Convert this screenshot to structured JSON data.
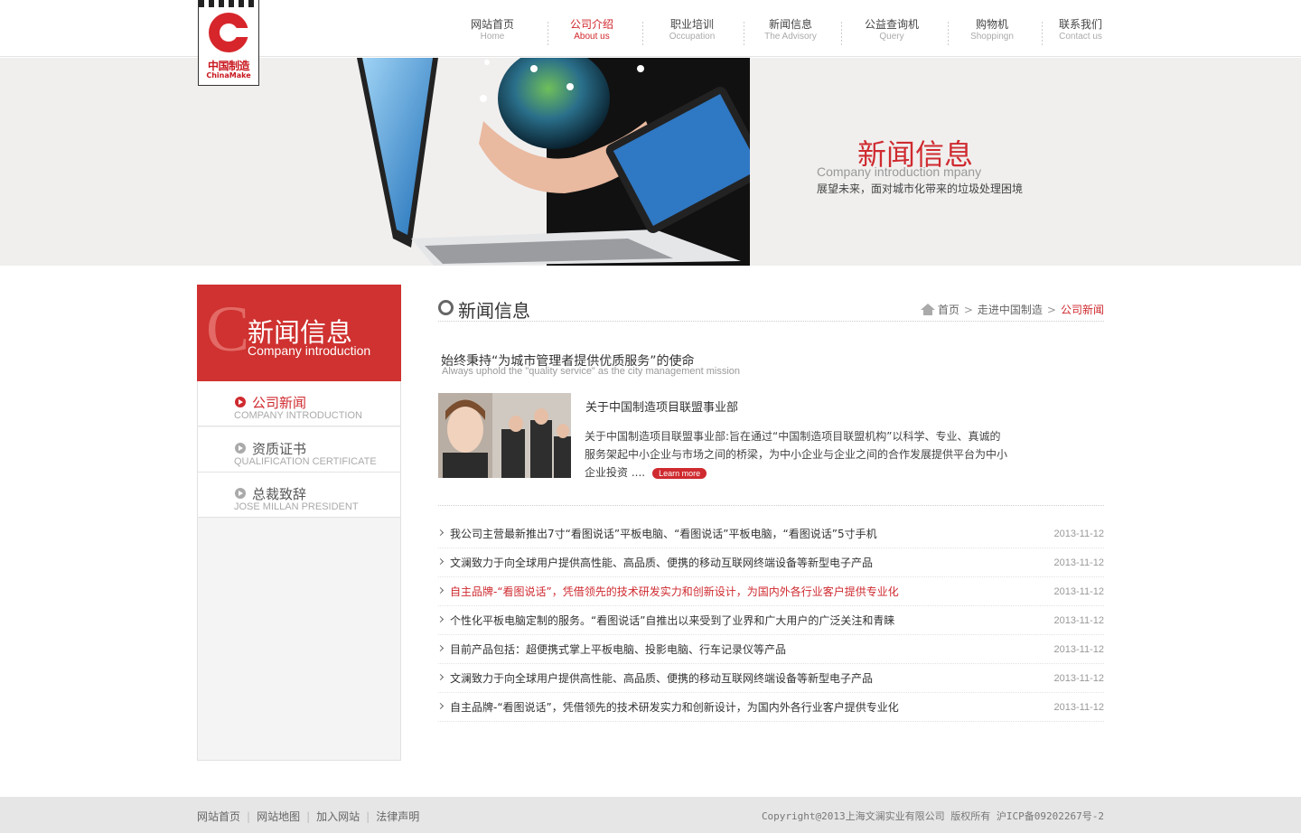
{
  "logo": {
    "cn": "中国制造",
    "en": "ChinaMake"
  },
  "nav": [
    {
      "zh": "网站首页",
      "en": "Home"
    },
    {
      "zh": "公司介绍",
      "en": "About us"
    },
    {
      "zh": "职业培训",
      "en": "Occupation"
    },
    {
      "zh": "新闻信息",
      "en": "The Advisory"
    },
    {
      "zh": "公益查询机",
      "en": "Query"
    },
    {
      "zh": "购物机",
      "en": "Shoppingn"
    },
    {
      "zh": "联系我们",
      "en": "Contact us"
    }
  ],
  "nav_active_index": 1,
  "banner": {
    "title": "新闻信息",
    "subtitle": "Company introduction mpany",
    "desc": "展望未来，面对城市化带来的垃圾处理困境"
  },
  "sidebar": {
    "head_letter": "C",
    "title": "新闻信息",
    "subtitle": "Company introduction",
    "items": [
      {
        "zh": "公司新闻",
        "en": "COMPANY INTRODUCTION",
        "active": true
      },
      {
        "zh": "资质证书",
        "en": "QUALIFICATION CERTIFICATE",
        "active": false
      },
      {
        "zh": "总裁致辞",
        "en": "JOSE MILLAN PRESIDENT",
        "active": false
      }
    ]
  },
  "main": {
    "title": "新闻信息",
    "breadcrumb": {
      "home": "首页",
      "level1": "走进中国制造",
      "current": "公司新闻"
    },
    "slogan": "始终秉持“为城市管理者提供优质服务”的使命",
    "slogan_en": "Always uphold the \"quality service\" as the city management mission",
    "feature": {
      "title": "关于中国制造项目联盟事业部",
      "text": "关于中国制造项目联盟事业部:旨在通过“中国制造项目联盟机构”以科学、专业、真诚的服务架起中小企业与市场之间的桥梁，为中小企业与企业之间的合作发展提供平台为中小企业投资 ....",
      "more": "Learn more"
    },
    "news": [
      {
        "text": "我公司主营最新推出7寸“看图说话”平板电脑、“看图说话”平板电脑，“看图说话”5寸手机",
        "date": "2013-11-12",
        "hot": false
      },
      {
        "text": "文澜致力于向全球用户提供高性能、高品质、便携的移动互联网终端设备等新型电子产品",
        "date": "2013-11-12",
        "hot": false
      },
      {
        "text": "自主品牌-“看图说话”，凭借领先的技术研发实力和创新设计，为国内外各行业客户提供专业化",
        "date": "2013-11-12",
        "hot": true
      },
      {
        "text": "个性化平板电脑定制的服务。“看图说话”自推出以来受到了业界和广大用户的广泛关注和青睐",
        "date": "2013-11-12",
        "hot": false
      },
      {
        "text": "目前产品包括：超便携式掌上平板电脑、投影电脑、行车记录仪等产品",
        "date": "2013-11-12",
        "hot": false
      },
      {
        "text": "文澜致力于向全球用户提供高性能、高品质、便携的移动互联网终端设备等新型电子产品",
        "date": "2013-11-12",
        "hot": false
      },
      {
        "text": "自主品牌-“看图说话”，凭借领先的技术研发实力和创新设计，为国内外各行业客户提供专业化",
        "date": "2013-11-12",
        "hot": false
      }
    ]
  },
  "footer": {
    "links": [
      "网站首页",
      "网站地图",
      "加入网站",
      "法律声明"
    ],
    "copyright": "Copyright@2013上海文澜实业有限公司 版权所有 沪ICP备09202267号-2"
  },
  "colors": {
    "accent": "#cf2a2f",
    "footer_bg": "#e6e6e6",
    "banner_bg": "#f0efee"
  },
  "icons": [
    "home-icon",
    "arrow-right-icon",
    "circle-play-icon",
    "ring-icon"
  ]
}
